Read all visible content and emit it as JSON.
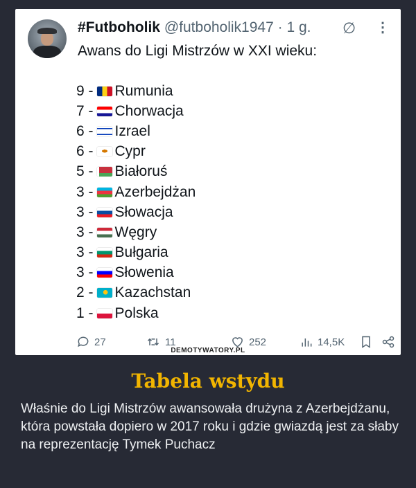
{
  "tweet": {
    "display_name": "#Futboholik",
    "handle": "@futboholik1947",
    "time": "· 1 g.",
    "intro": "Awans do Ligi Mistrzów w XXI wieku:",
    "rows": [
      {
        "count": "9 -",
        "country": "Rumunia",
        "flag_colors": [
          "#002b7f",
          "#fcd116",
          "#ce1126"
        ],
        "flag_layout": "vertical"
      },
      {
        "count": "7 -",
        "country": "Chorwacja",
        "flag_colors": [
          "#ff0000",
          "#ffffff",
          "#171796"
        ],
        "flag_layout": "horizontal"
      },
      {
        "count": "6 -",
        "country": "Izrael",
        "flag_colors": [
          "#ffffff",
          "#0038b8",
          "#ffffff"
        ],
        "flag_layout": "israel"
      },
      {
        "count": "6 -",
        "country": "Cypr",
        "flag_colors": [
          "#ffffff",
          "#d57800",
          "#4e5b31"
        ],
        "flag_layout": "cyprus"
      },
      {
        "count": "5 -",
        "country": "Białoruś",
        "flag_colors": [
          "#c8313e",
          "#c8313e",
          "#4aa657"
        ],
        "flag_layout": "belarus"
      },
      {
        "count": "3 -",
        "country": "Azerbejdżan",
        "flag_colors": [
          "#00b5e2",
          "#ef3340",
          "#509e2f"
        ],
        "flag_layout": "horizontal"
      },
      {
        "count": "3 -",
        "country": "Słowacja",
        "flag_colors": [
          "#ffffff",
          "#0b4ea2",
          "#ee1c25"
        ],
        "flag_layout": "horizontal"
      },
      {
        "count": "3 -",
        "country": "Węgry",
        "flag_colors": [
          "#ce2939",
          "#ffffff",
          "#477050"
        ],
        "flag_layout": "horizontal"
      },
      {
        "count": "3 -",
        "country": "Bułgaria",
        "flag_colors": [
          "#ffffff",
          "#00966e",
          "#d62612"
        ],
        "flag_layout": "horizontal"
      },
      {
        "count": "3 -",
        "country": "Słowenia",
        "flag_colors": [
          "#ffffff",
          "#0000ff",
          "#ff0000"
        ],
        "flag_layout": "horizontal"
      },
      {
        "count": "2 -",
        "country": "Kazachstan",
        "flag_colors": [
          "#00afca",
          "#fec50c",
          "#00afca"
        ],
        "flag_layout": "kazakhstan"
      },
      {
        "count": "1 -",
        "country": "Polska",
        "flag_colors": [
          "#ffffff",
          "#dc143c"
        ],
        "flag_layout": "poland"
      }
    ],
    "replies": "27",
    "retweets": "11",
    "likes": "252",
    "views": "14,5K"
  },
  "watermark": "DEMOTYWATORY.PL",
  "post": {
    "title": "Tabela wstydu",
    "caption": "Właśnie do Ligi Mistrzów awansowała drużyna z Azerbejdżanu, która powstała dopiero w 2017 roku i gdzie gwiazdą jest za słaby na reprezentację Tymek Puchacz"
  },
  "colors": {
    "background": "#272a35",
    "title": "#f2b500",
    "muted": "#536471"
  }
}
